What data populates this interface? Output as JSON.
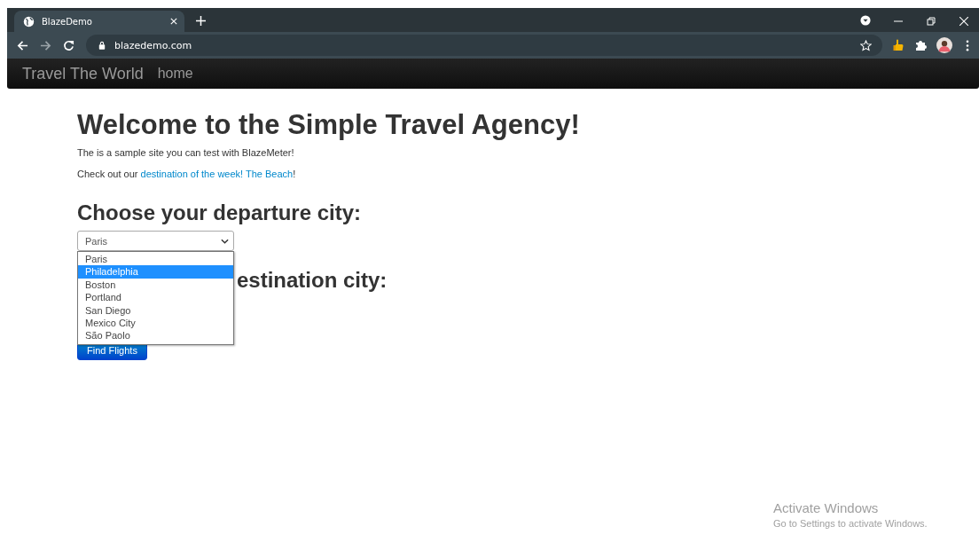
{
  "browser": {
    "tab": {
      "title": "BlazeDemo",
      "selected": true
    },
    "address": "blazedemo.com"
  },
  "navbar": {
    "brand": "Travel The World",
    "links": [
      "home"
    ]
  },
  "page": {
    "title": "Welcome to the Simple Travel Agency!",
    "intro": "The is a sample site you can test with BlazeMeter!",
    "promo": {
      "before": "Check out our ",
      "link": "destination of the week! The Beach",
      "after": "!"
    },
    "departure": {
      "heading": "Choose your departure city:",
      "value": "Paris",
      "expanded": true,
      "options": [
        {
          "label": "Paris",
          "highlighted": false
        },
        {
          "label": "Philadelphia",
          "highlighted": true
        },
        {
          "label": "Boston",
          "highlighted": false
        },
        {
          "label": "Portland",
          "highlighted": false
        },
        {
          "label": "San Diego",
          "highlighted": false
        },
        {
          "label": "Mexico City",
          "highlighted": false
        },
        {
          "label": "São Paolo",
          "highlighted": false
        }
      ]
    },
    "destination": {
      "heading": "estination city:"
    },
    "button": "Find Flights"
  },
  "os_notice": {
    "title": "Activate Windows",
    "subtitle": "Go to Settings to activate Windows."
  }
}
